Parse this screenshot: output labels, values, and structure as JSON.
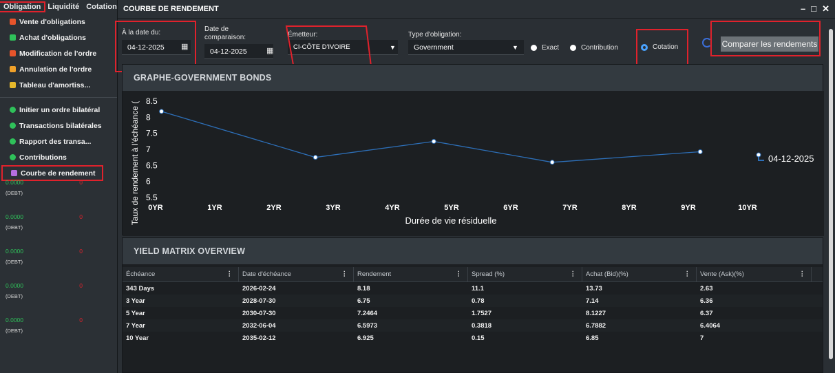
{
  "menubar": {
    "items": [
      "Obligation",
      "Liquidité",
      "Cotation"
    ]
  },
  "sidebar": {
    "items": [
      {
        "label": "Vente d'obligations",
        "color": "#e6542b"
      },
      {
        "label": "Achat d'obligations",
        "color": "#2fc15a"
      },
      {
        "label": "Modification de l'ordre",
        "color": "#e6542b"
      },
      {
        "label": "Annulation de l'ordre",
        "color": "#f0a12a"
      },
      {
        "label": "Tableau d'amortiss...",
        "color": "#e6b82b"
      },
      {
        "label": "Initier un ordre bilatéral",
        "color": "#2fc15a"
      },
      {
        "label": "Transactions bilatérales",
        "color": "#2fc15a"
      },
      {
        "label": "Rapport des transa...",
        "color": "#2fc15a"
      },
      {
        "label": "Contributions",
        "color": "#2fc15a"
      },
      {
        "label": "Courbe de rendement",
        "color": "#b56ee0"
      }
    ],
    "strips": [
      {
        "value": "0.0000",
        "count": "0",
        "tag": "(DEBT)"
      },
      {
        "value": "0.0000",
        "count": "0",
        "tag": "(DEBT)"
      },
      {
        "value": "0.0000",
        "count": "0",
        "tag": "(DEBT)"
      },
      {
        "value": "0.0000",
        "count": "0",
        "tag": "(DEBT)"
      },
      {
        "value": "0.0000",
        "count": "0",
        "tag": "(DEBT)"
      }
    ]
  },
  "window": {
    "title": "COURBE DE RENDEMENT",
    "controls": [
      "–",
      "□",
      "✕"
    ]
  },
  "filters": {
    "date_label": "À la date du:",
    "date_value": "04-12-2025",
    "compare_label": "Date de comparaison:",
    "compare_value": "04-12-2025",
    "issuer_label": "Émetteur:",
    "issuer_value": "CI-CÔTE D'IVOIRE",
    "type_label": "Type d'obligation:",
    "type_value": "Government",
    "radios": [
      {
        "label": "Exact",
        "selected": false
      },
      {
        "label": "Contribution",
        "selected": false
      },
      {
        "label": "Cotation",
        "selected": true
      }
    ],
    "compare_button": "Comparer les rendements"
  },
  "chart_panel": {
    "title": "GRAPHE-GOVERNMENT BONDS"
  },
  "chart_data": {
    "type": "line",
    "ylabel": "Taux de rendement à l'échéance (",
    "xlabel": "Durée de vie résiduelle",
    "x_ticks": [
      "0YR",
      "1YR",
      "2YR",
      "3YR",
      "4YR",
      "5YR",
      "6YR",
      "7YR",
      "8YR",
      "9YR",
      "10YR"
    ],
    "y_ticks": [
      "5.5",
      "6",
      "6.5",
      "7",
      "7.5",
      "8",
      "8.5"
    ],
    "ylim": [
      5.5,
      8.5
    ],
    "xlim": [
      0,
      10
    ],
    "series": [
      {
        "name": "04-12-2025",
        "color": "#2d6fb8",
        "x": [
          0.1,
          2.7,
          4.7,
          6.7,
          9.2
        ],
        "y": [
          8.18,
          6.75,
          7.2464,
          6.5973,
          6.925
        ]
      }
    ],
    "legend_position": "right"
  },
  "matrix": {
    "title": "YIELD MATRIX OVERVIEW",
    "columns": [
      "Échéance",
      "Date d'échéance",
      "Rendement",
      "Spread (%)",
      "Achat (Bid)(%)",
      "Vente (Ask)(%)"
    ],
    "rows": [
      [
        "343 Days",
        "2026-02-24",
        "8.18",
        "11.1",
        "13.73",
        "2.63"
      ],
      [
        "3 Year",
        "2028-07-30",
        "6.75",
        "0.78",
        "7.14",
        "6.36"
      ],
      [
        "5 Year",
        "2030-07-30",
        "7.2464",
        "1.7527",
        "8.1227",
        "6.37"
      ],
      [
        "7 Year",
        "2032-06-04",
        "6.5973",
        "0.3818",
        "6.7882",
        "6.4064"
      ],
      [
        "10 Year",
        "2035-02-12",
        "6.925",
        "0.15",
        "6.85",
        "7"
      ]
    ]
  }
}
